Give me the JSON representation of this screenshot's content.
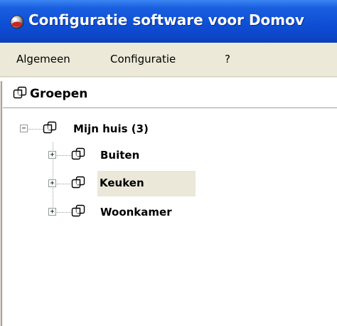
{
  "window": {
    "title": "Configuratie software voor Domov",
    "icon": "app-globe-icon"
  },
  "menu": {
    "items": [
      {
        "label": "Algemeen"
      },
      {
        "label": "Configuratie"
      },
      {
        "label": "?"
      }
    ]
  },
  "panel": {
    "title": "Groepen",
    "icon": "group-folder-icon"
  },
  "tree": {
    "root": {
      "label": "Mijn huis (3)",
      "expanded": true,
      "icon": "group-folder-icon"
    },
    "children": [
      {
        "label": "Buiten",
        "expanded": false,
        "selected": false
      },
      {
        "label": "Keuken",
        "expanded": false,
        "selected": true
      },
      {
        "label": "Woonkamer",
        "expanded": false,
        "selected": false
      }
    ]
  },
  "colors": {
    "titlebar": "#0f4fd6",
    "menubar": "#ece9d8",
    "selection": "#ebe8da"
  }
}
